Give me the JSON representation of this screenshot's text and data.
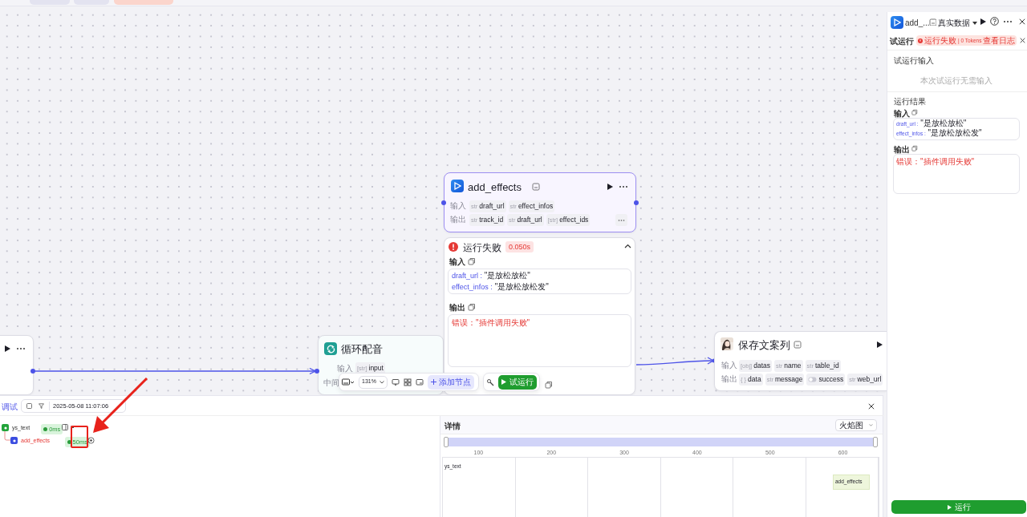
{
  "canvas": {
    "loop_node": {
      "title": "循环配音",
      "input_label": "输入",
      "inputs": [
        {
          "type": "[str]",
          "name": "input"
        }
      ],
      "middle_label": "中间"
    },
    "effects_node": {
      "title": "add_effects",
      "selected": true,
      "input_label": "输入",
      "inputs": [
        {
          "type": "str",
          "name": "draft_url"
        },
        {
          "type": "str",
          "name": "effect_infos"
        }
      ],
      "output_label": "输出",
      "outputs": [
        {
          "type": "str",
          "name": "track_id"
        },
        {
          "type": "str",
          "name": "draft_url"
        },
        {
          "type": "[str]",
          "name": "effect_ids"
        }
      ]
    },
    "run_result": {
      "status": "运行失败",
      "duration": "0.050s",
      "expanded": true,
      "input_label": "输入",
      "inputs": [
        {
          "key": "draft_url :",
          "value": " \"是放松放松\""
        },
        {
          "key": "effect_infos :",
          "value": " \"是放松放松发\""
        }
      ],
      "output_label": "输出",
      "error": "错误：\"插件调用失败\""
    },
    "save_node": {
      "title": "保存文案列",
      "input_label": "输入",
      "inputs": [
        {
          "type": "[obj]",
          "name": "datas"
        },
        {
          "type": "str",
          "name": "name"
        },
        {
          "type": "str",
          "name": "table_id"
        }
      ],
      "output_label": "输出",
      "outputs": [
        {
          "kind": "text",
          "type": "{ }",
          "name": "data"
        },
        {
          "kind": "text",
          "type": "str",
          "name": "message"
        },
        {
          "kind": "bool",
          "name": "success"
        },
        {
          "kind": "text",
          "type": "str",
          "name": "web_url"
        }
      ]
    }
  },
  "toolbar": {
    "zoom": "131%",
    "add_node": "添加节点",
    "test_run": "试运行"
  },
  "side_panel": {
    "title": "add_...",
    "data_source": "真实数据",
    "section_title": "试运行",
    "status": "运行失败",
    "tokens": "| 0 Tokens",
    "log_link": "查看日志",
    "input_title": "试运行输入",
    "input_empty": "本次试运行无需输入",
    "result_title": "运行结果",
    "input_label": "输入",
    "inputs": [
      {
        "key": "draft_url :",
        "value": " \"是放松放松\""
      },
      {
        "key": "effect_infos :",
        "value": " \"是放松放松发\""
      }
    ],
    "output_label": "输出",
    "error": "错误：\"插件调用失败\"",
    "run_button": "运行"
  },
  "debug_panel": {
    "title": "调试",
    "timestamp": "2025-05-08 11:07:06",
    "trace": [
      {
        "kind": "workflow",
        "name": "ys_text",
        "duration": "0ms",
        "failed": false,
        "children": [
          {
            "kind": "plugin",
            "name": "add_effects",
            "duration": "50ms",
            "failed": true
          }
        ]
      }
    ],
    "detail_title": "详情",
    "view": "火焰图",
    "range": {
      "level": 1
    },
    "ticks": [
      "100",
      "200",
      "300",
      "400",
      "500",
      "600"
    ],
    "flame": [
      {
        "kind": "label",
        "label": "ys_text"
      },
      {
        "kind": "bar",
        "label": "add_effects"
      }
    ]
  }
}
